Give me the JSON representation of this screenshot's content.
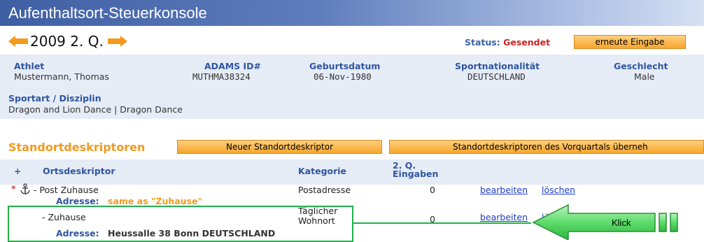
{
  "app": {
    "title": "Aufenthaltsort-Steuerkonsole"
  },
  "quarter_bar": {
    "prev_icon": "left-arrow-icon",
    "next_icon": "right-arrow-icon",
    "period": "2009 2. Q.",
    "status_label": "Status:",
    "status_value": "Gesendet",
    "reenter_button": "erneute Eingabe"
  },
  "athlete": {
    "labels": {
      "athlete": "Athlet",
      "adams_id": "ADAMS ID#",
      "birthdate": "Geburtsdatum",
      "nationality": "Sportnationalität",
      "gender": "Geschlecht",
      "sport": "Sportart / Disziplin"
    },
    "name": "Mustermann, Thomas",
    "adams_id": "MUTHMA38324",
    "birthdate": "06-Nov-1980",
    "nationality": "DEUTSCHLAND",
    "gender": "Male",
    "sport": "Dragon and Lion Dance | Dragon Dance"
  },
  "descriptors": {
    "title": "Standortdeskriptoren",
    "new_button": "Neuer Standortdeskriptor",
    "copy_button": "Standortdeskriptoren des Vorquartals überneh",
    "columns": {
      "plus": "+",
      "descriptor": "Ortsdeskriptor",
      "category": "Kategorie",
      "entries_line1": "2. Q.",
      "entries_line2": "Eingaben"
    },
    "rows": [
      {
        "marker": "*",
        "icon": "anchor-icon",
        "name": "- Post Zuhause",
        "address_label": "Adresse:",
        "address": "same as \"Zuhause\"",
        "category": "Postadresse",
        "entries": "0",
        "edit": "bearbeiten",
        "delete": "löschen"
      },
      {
        "name": "- Zuhause",
        "address_label": "Adresse:",
        "address": "Heussalle 38 Bonn DEUTSCHLAND",
        "category_line1": "Täglicher",
        "category_line2": "Wohnort",
        "entries": "0",
        "edit": "bearbeiten",
        "delete": "lö"
      }
    ]
  },
  "callout": {
    "label": "Klick",
    "color": "#5ddc6a"
  },
  "colors": {
    "accent": "#f39a1d",
    "header_blue": "#2f55a0",
    "panel": "#e6ecf6",
    "status_red": "#cc2222",
    "highlight_green": "#22b14c"
  }
}
